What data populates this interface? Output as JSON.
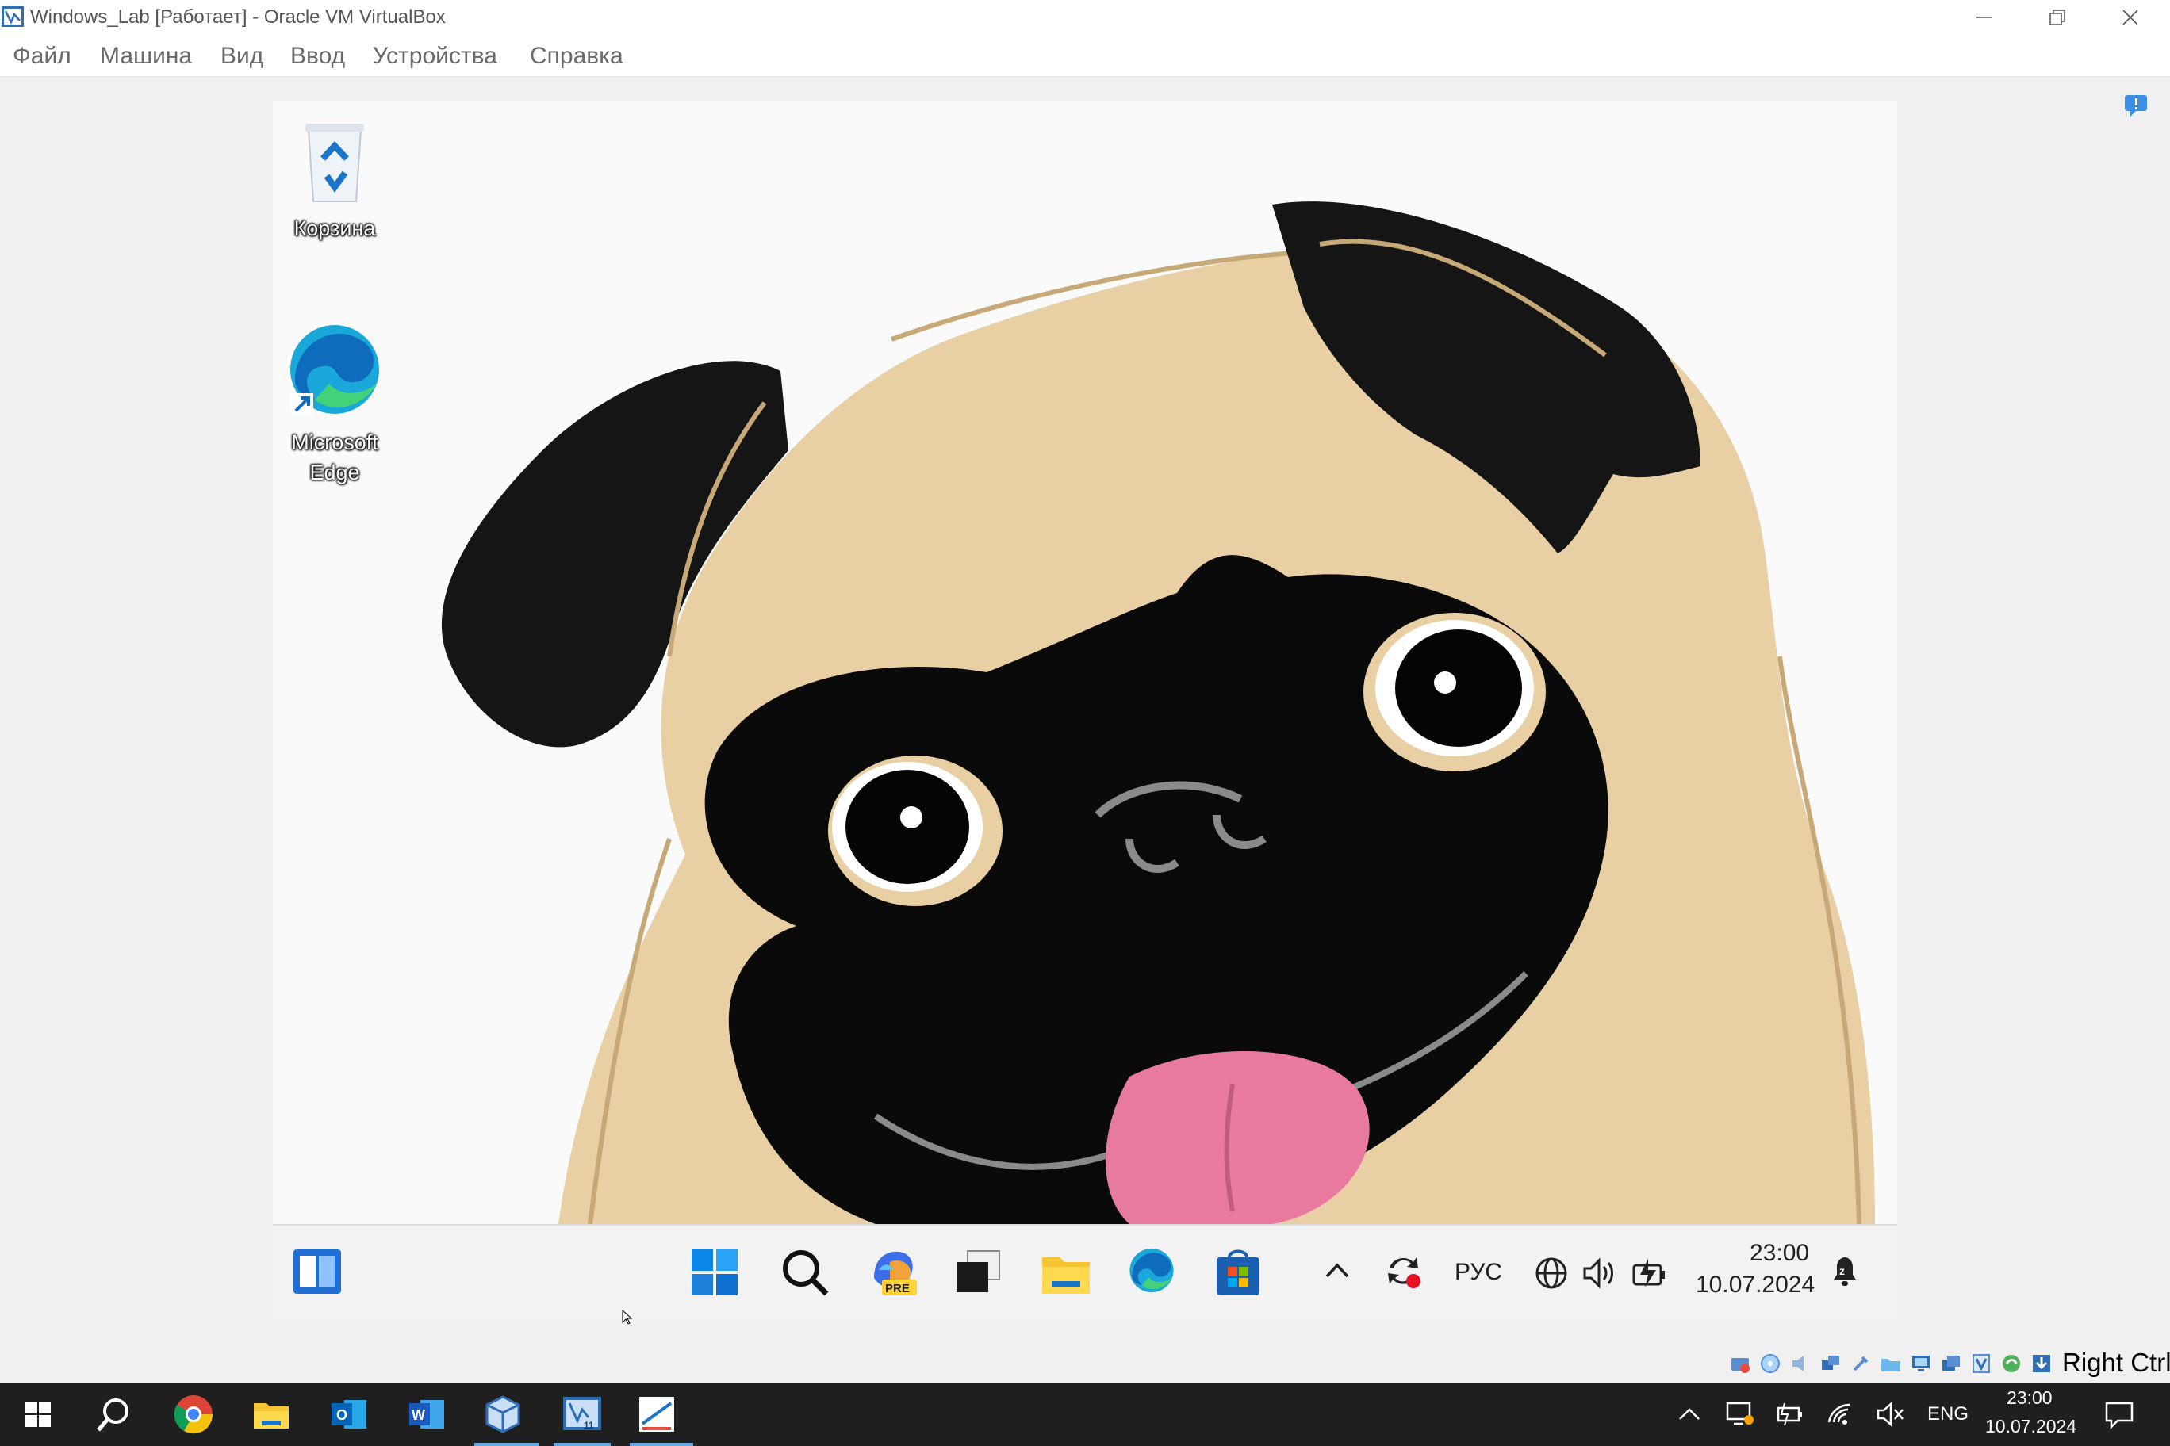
{
  "host_window": {
    "title": "Windows_Lab [Работает] - Oracle VM VirtualBox",
    "menu": [
      "Файл",
      "Машина",
      "Вид",
      "Ввод",
      "Устройства",
      "Справка"
    ],
    "controls": [
      "minimize",
      "restore",
      "close"
    ]
  },
  "guest": {
    "desktop_icons": [
      {
        "label": "Корзина",
        "icon": "recycle-bin-icon"
      },
      {
        "label": "Microsoft Edge",
        "icon": "edge-icon"
      }
    ],
    "wallpaper": "pug-illustration",
    "taskbar": {
      "pinned": [
        "widgets-icon",
        "start-icon",
        "search-icon",
        "copilot-pre-icon",
        "task-view-icon",
        "file-explorer-icon",
        "edge-icon",
        "store-icon"
      ],
      "tray": {
        "language": "РУС",
        "time": "23:00",
        "date": "10.07.2024"
      }
    }
  },
  "vbox_status": {
    "host_key": "Right Ctrl"
  },
  "host_taskbar": {
    "apps": [
      "windows-start-icon",
      "search-icon",
      "chrome-icon",
      "file-explorer-icon",
      "outlook-icon",
      "word-icon",
      "virtualbox-icon",
      "virtualbox-vm-icon",
      "snipping-tool-icon"
    ],
    "tray": {
      "language": "ENG",
      "time": "23:00",
      "date": "10.07.2024"
    }
  },
  "colors": {
    "pug_fawn": "#e8cfa4",
    "pug_mask": "#0a0a0a",
    "tongue": "#e87aa0",
    "host_taskbar": "#1f1f1f",
    "accent": "#0078d4"
  }
}
